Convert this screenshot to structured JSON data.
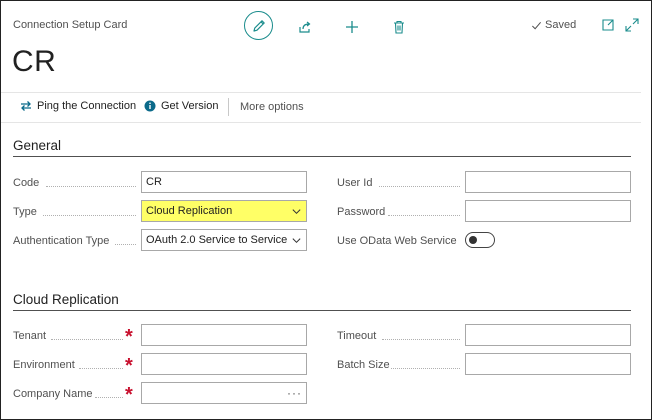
{
  "header": {
    "caption": "Connection Setup Card",
    "title": "CR",
    "saved_label": "Saved",
    "icons": [
      "edit-icon",
      "share-icon",
      "new-icon",
      "delete-icon",
      "checkmark-icon",
      "open-in-new-window-icon",
      "expand-icon"
    ]
  },
  "actions": {
    "ping": "Ping the Connection",
    "get_version": "Get Version",
    "more_options": "More options"
  },
  "general": {
    "title": "General",
    "code_label": "Code",
    "code_value": "CR",
    "type_label": "Type",
    "type_value": "Cloud Replication",
    "auth_label": "Authentication Type",
    "auth_value": "OAuth 2.0 Service to Service",
    "user_id_label": "User Id",
    "user_id_value": "",
    "password_label": "Password",
    "password_value": "",
    "odata_label": "Use OData Web Service",
    "odata_enabled": false
  },
  "cloud": {
    "title": "Cloud Replication",
    "tenant_label": "Tenant",
    "tenant_value": "",
    "environment_label": "Environment",
    "environment_value": "",
    "company_label": "Company Name",
    "company_value": "",
    "company_lookup": "···",
    "timeout_label": "Timeout",
    "timeout_value": "",
    "batch_label": "Batch Size",
    "batch_value": "",
    "required_mark": "*"
  },
  "colors": {
    "accent": "#1a8c8c",
    "highlight": "#ffff66",
    "required": "#c8102e",
    "info": "#0b6a8a"
  }
}
